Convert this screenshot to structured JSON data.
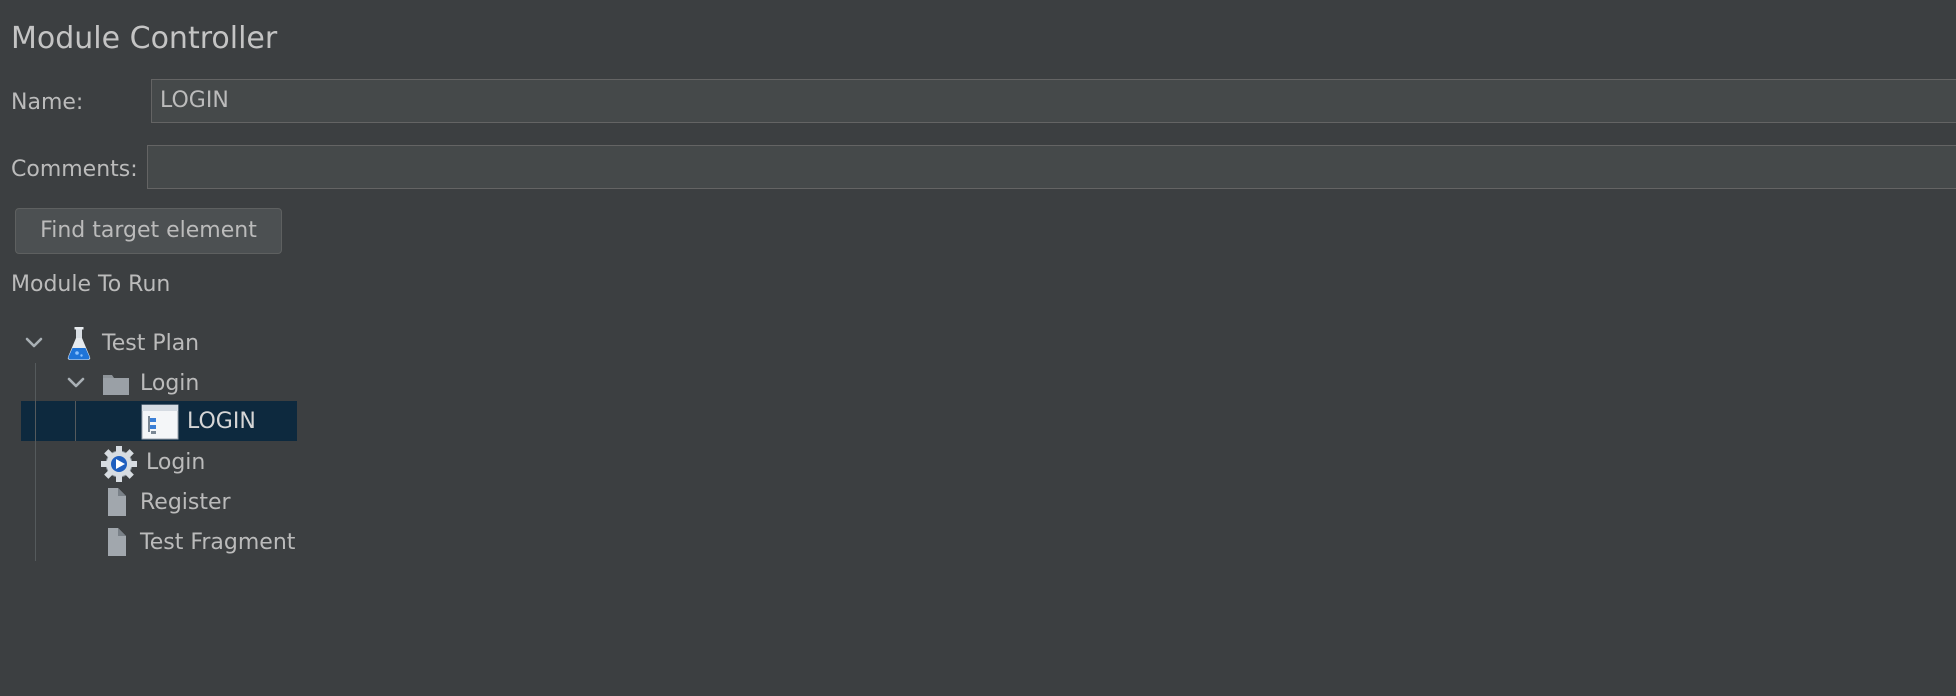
{
  "panel": {
    "title": "Module Controller"
  },
  "form": {
    "name_label": "Name:",
    "name_value": "LOGIN",
    "comments_label": "Comments:",
    "comments_value": ""
  },
  "actions": {
    "find_target_label": "Find target element"
  },
  "module_section": {
    "label": "Module To Run"
  },
  "tree": {
    "nodes": [
      {
        "label": "Test Plan",
        "icon": "flask-icon",
        "expanded": true,
        "selected": false
      },
      {
        "label": "Login",
        "icon": "folder-icon",
        "expanded": true,
        "selected": false
      },
      {
        "label": "LOGIN",
        "icon": "simple-controller-icon",
        "expanded": false,
        "selected": true
      },
      {
        "label": "Login",
        "icon": "gear-icon",
        "expanded": false,
        "selected": false
      },
      {
        "label": "Register",
        "icon": "page-icon",
        "expanded": false,
        "selected": false
      },
      {
        "label": "Test Fragment",
        "icon": "page-icon",
        "expanded": false,
        "selected": false
      }
    ]
  },
  "colors": {
    "background": "#3c3f41",
    "field_background": "#45494a",
    "selection": "#0d293e",
    "text": "#bbbbbb"
  }
}
